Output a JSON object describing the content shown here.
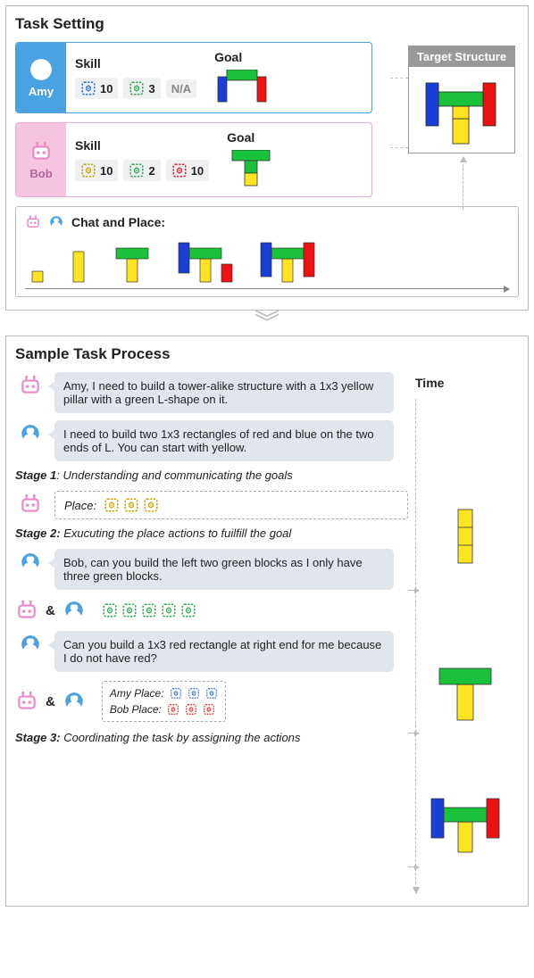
{
  "top": {
    "title": "Task Setting",
    "amy": {
      "name": "Amy",
      "skill_label": "Skill",
      "goal_label": "Goal",
      "skills": [
        {
          "color": "#2e6fd8",
          "value": "10"
        },
        {
          "color": "#2fa84f",
          "value": "3"
        },
        {
          "na": true,
          "value": "N/A"
        }
      ],
      "goal_blocks": "amy-goal"
    },
    "bob": {
      "name": "Bob",
      "skill_label": "Skill",
      "goal_label": "Goal",
      "skills": [
        {
          "color": "#c9a300",
          "value": "10"
        },
        {
          "color": "#2fa84f",
          "value": "2"
        },
        {
          "color": "#d22",
          "value": "10"
        }
      ],
      "goal_blocks": "bob-goal"
    },
    "chat_label": "Chat and Place:",
    "target_label": "Target Structure"
  },
  "bottom": {
    "title": "Sample Task Process",
    "time_label": "Time",
    "msg1": "Amy, I need to build a tower-alike structure with a 1x3 yellow pillar with a green L-shape on it.",
    "msg2": "I need to build two 1x3 rectangles of red and blue on the two ends of L. You can start with yellow.",
    "stage1": {
      "b": "Stage 1",
      "t": ": Understanding and communicating the goals"
    },
    "place_label": "Place:",
    "stage2": {
      "b": "Stage 2:",
      "t": " Exucuting the place actions to fuilfill the goal"
    },
    "msg3": "Bob, can you build the left two green blocks as I only have three green blocks.",
    "msg4": "Can you build a 1x3 red rectangle at right end for me because I do not have red?",
    "amy_place": "Amy Place:",
    "bob_place": "Bob Place:",
    "stage3": {
      "b": "Stage 3:",
      "t": " Coordinating the task by assigning the actions"
    }
  },
  "chart_data": {
    "type": "table",
    "agents": [
      {
        "name": "Amy",
        "skills": {
          "blue": 10,
          "green": 3,
          "red": null
        },
        "goal": "blue+red pillars on ends of green L"
      },
      {
        "name": "Bob",
        "skills": {
          "yellow": 10,
          "green": 2,
          "red": 10
        },
        "goal": "yellow pillar + green L top"
      }
    ],
    "target_structure": {
      "yellow_pillar": "1x3",
      "green_L": "on top",
      "blue_pillar": "left 1x3",
      "red_pillar": "right 1x3"
    },
    "process_stages": [
      "Understanding and communicating the goals",
      "Executing the place actions to fulfill the goal",
      "Coordinating the task by assigning the actions"
    ],
    "timeline_states": [
      "yellow pillar",
      "yellow+green L",
      "full structure"
    ]
  }
}
